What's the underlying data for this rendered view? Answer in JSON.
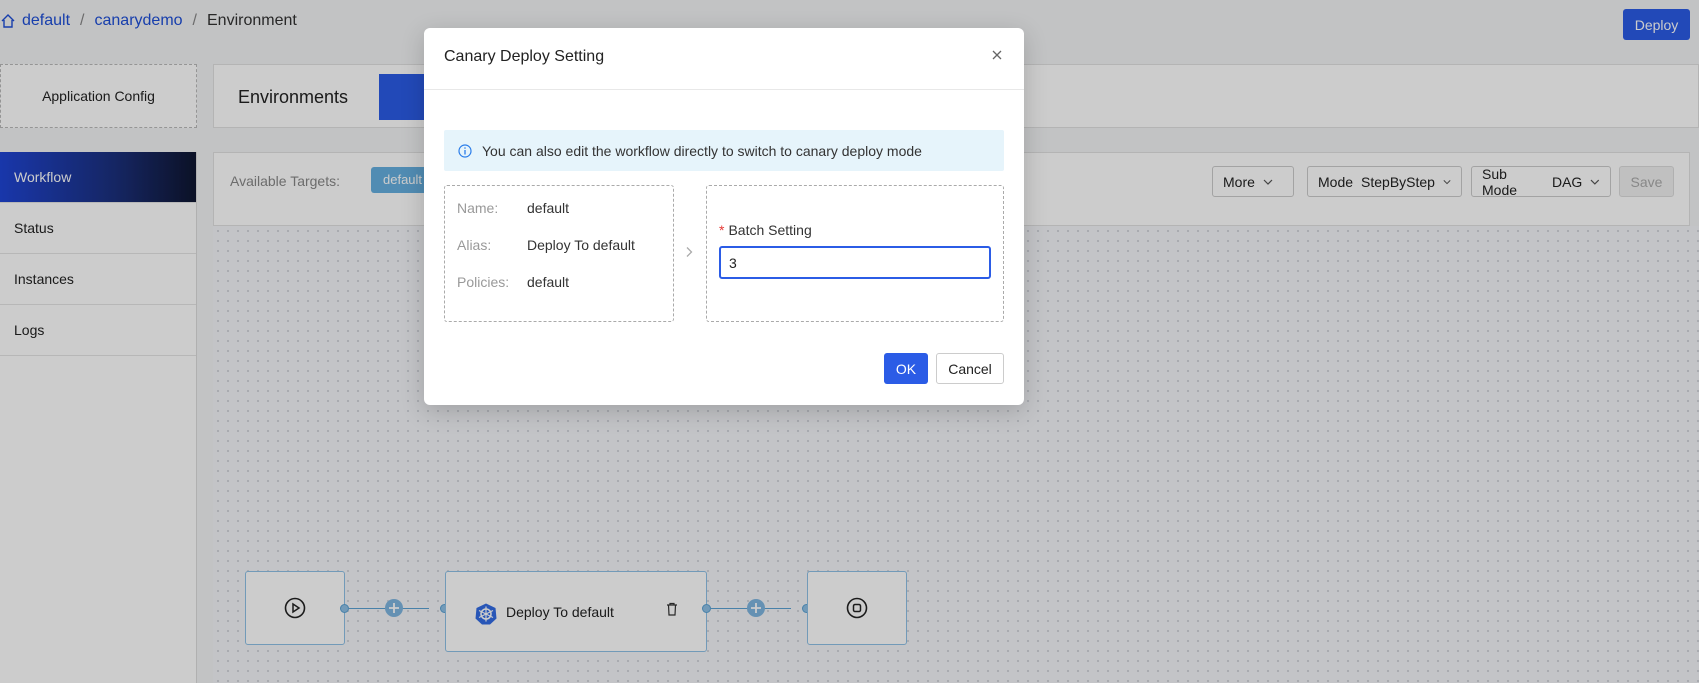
{
  "breadcrumb": {
    "items": [
      "default",
      "canarydemo"
    ],
    "current": "Environment",
    "separator": "/"
  },
  "header": {
    "deploy_label": "Deploy"
  },
  "left": {
    "app_config_label": "Application Config",
    "menu": [
      {
        "label": "Workflow",
        "active": true
      },
      {
        "label": "Status"
      },
      {
        "label": "Instances"
      },
      {
        "label": "Logs"
      }
    ]
  },
  "environments": {
    "title": "Environments"
  },
  "targets": {
    "label": "Available Targets:",
    "chip": "default",
    "more_label": "More",
    "mode_label": "Mode",
    "mode_value": "StepByStep",
    "submode_label": "Sub Mode",
    "submode_value": "DAG",
    "save_label": "Save"
  },
  "workflow": {
    "step_label": "Deploy To default"
  },
  "modal": {
    "title": "Canary Deploy Setting",
    "info": "You can also edit the workflow directly to switch to canary deploy mode",
    "target": {
      "name_key": "Name:",
      "name_val": "default",
      "alias_key": "Alias:",
      "alias_val": "Deploy To default",
      "policies_key": "Policies:",
      "policies_val": "default"
    },
    "batch_label": "Batch Setting",
    "batch_required_mark": "*",
    "batch_value": "3",
    "ok_label": "OK",
    "cancel_label": "Cancel"
  },
  "colors": {
    "primary": "#2b5ce6",
    "info_bg": "#e6f4fb",
    "link": "#1d4ed8"
  }
}
